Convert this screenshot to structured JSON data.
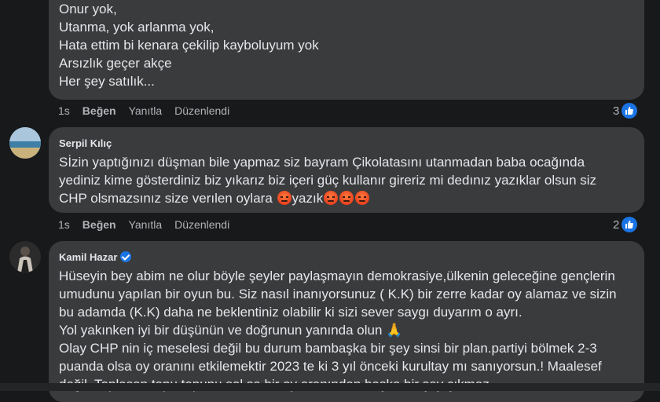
{
  "comments": [
    {
      "lines": [
        "Onur yok,",
        "Utanma, yok arlanma yok,",
        "Hata ettim bi kenara çekilip kayboluyum yok",
        "Arsızlık geçer akçe",
        "Her şey satılık..."
      ],
      "time": "1s",
      "like_label": "Beğen",
      "reply_label": "Yanıtla",
      "edited_label": "Düzenlendi",
      "reaction_count": "3"
    },
    {
      "author": "Serpil Kılıç",
      "lines": [
        "Sİzin yaptığınızı düşman bile yapmaz siz bayram Çikolatasını utanmadan baba ocağında",
        "yediniz kime gösterdiniz biz yıkarız biz içeri güç kullanır gireriz mi dedınız yazıklar olsun siz",
        "CHP olsmazsınız size verılen oylara"
      ],
      "last_line_suffix": "yazık",
      "emoji_icon": "angry-face-icon",
      "time": "1s",
      "like_label": "Beğen",
      "reply_label": "Yanıtla",
      "edited_label": "Düzenlendi",
      "reaction_count": "2"
    },
    {
      "author": "Kamil Hazar",
      "verified": true,
      "lines": [
        "Hüseyin bey abim ne olur böyle şeyler paylaşmayın demokrasiye,ülkenin geleceğine gençlerin",
        "umudunu yapılan bir oyun bu. Siz nasıl inanıyorsunuz ( K.K) bir zerre kadar oy alamaz ve sizin",
        "bu adamda (K.K) daha ne beklentiniz olabilir ki sizi sever saygı duyarım o ayrı.",
        "Yol yakınken iyi bir düşünün ve doğrunun yanında olun",
        "Olay CHP nin iç meselesi değil bu durum bambaşka bir şey sinsi bir plan.partiyi bölmek 2-3",
        "puanda olsa oy oranını etkilemektir 2023 te ki 3 yıl önceki kurultay mı sanıyorsun.! Maalesef",
        "değil. Toplasan topu topunu sol sa bir oy oranından başka bir şey çıkmaz"
      ],
      "pray_icon": "praying-hands-icon"
    }
  ],
  "like_icon": "thumbs-up-icon",
  "colors": {
    "background": "#18191a",
    "bubble": "#3a3b3c",
    "text": "#e4e6eb",
    "secondary": "#b0b3b8",
    "accent": "#1b74e4"
  }
}
